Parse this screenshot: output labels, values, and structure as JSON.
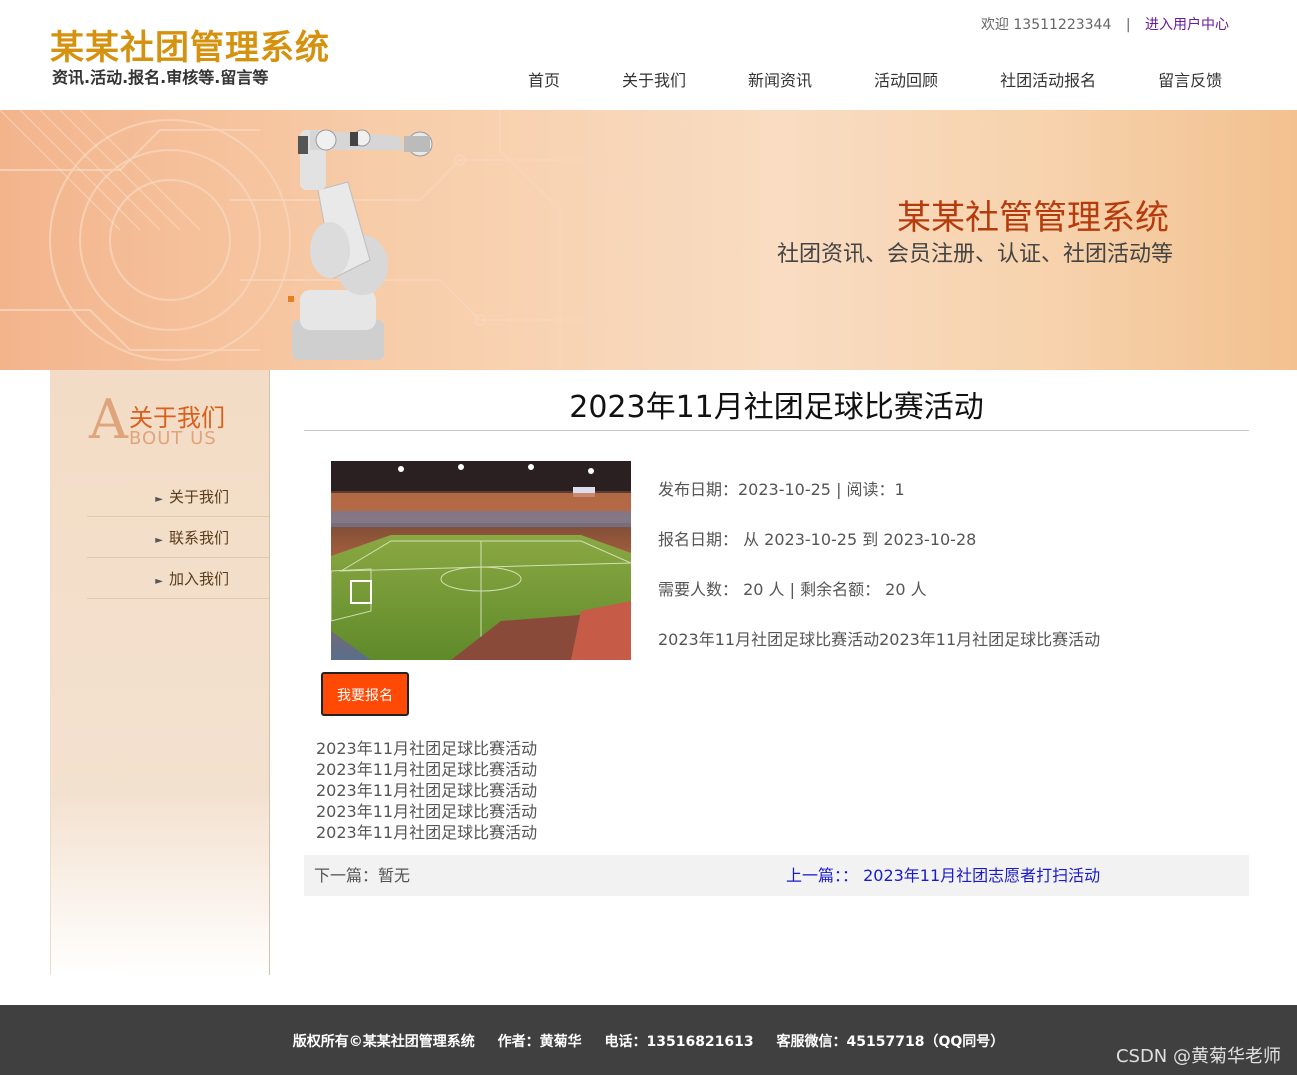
{
  "header": {
    "logo_title": "某某社团管理系统",
    "logo_subtitle": "资讯.活动.报名.审核等.留言等",
    "welcome": "欢迎 13511223344",
    "separator": "|",
    "user_center": "进入用户中心",
    "nav": [
      "首页",
      "关于我们",
      "新闻资讯",
      "活动回顾",
      "社团活动报名",
      "留言反馈"
    ]
  },
  "banner": {
    "title": "某某社管管理系统",
    "subtitle": "社团资讯、会员注册、认证、社团活动等"
  },
  "sidebar": {
    "letter": "A",
    "heading_cn": "关于我们",
    "heading_en": "BOUT US",
    "items": [
      "关于我们",
      "联系我们",
      "加入我们"
    ]
  },
  "article": {
    "title": "2023年11月社团足球比赛活动",
    "publish_line": "发布日期：2023-10-25  |  阅读：1",
    "signup_date_line": "报名日期：  从 2023-10-25  到 2023-10-28",
    "quota_line": "需要人数：  20 人       | 剩余名额：  20 人",
    "summary": "2023年11月社团足球比赛活动2023年11月社团足球比赛活动",
    "signup_button": "我要报名",
    "description_lines": [
      "2023年11月社团足球比赛活动",
      "2023年11月社团足球比赛活动",
      "2023年11月社团足球比赛活动",
      "2023年11月社团足球比赛活动",
      "2023年11月社团足球比赛活动"
    ],
    "next_label": "下一篇：暂无",
    "prev_label": "上一篇：：  2023年11月社团志愿者打扫活动"
  },
  "footer": {
    "copyright": "版权所有©某某社团管理系统",
    "author": "作者：黄菊华",
    "phone": "电话：13516821613",
    "wechat": "客服微信：45157718（QQ同号）",
    "watermark": "CSDN @黄菊华老师"
  },
  "colors": {
    "logo": "#d4920f",
    "banner_title": "#b53a0c",
    "signup_button": "#ff4a06",
    "prev_link": "#1a1acc",
    "footer_bg": "#404040"
  }
}
